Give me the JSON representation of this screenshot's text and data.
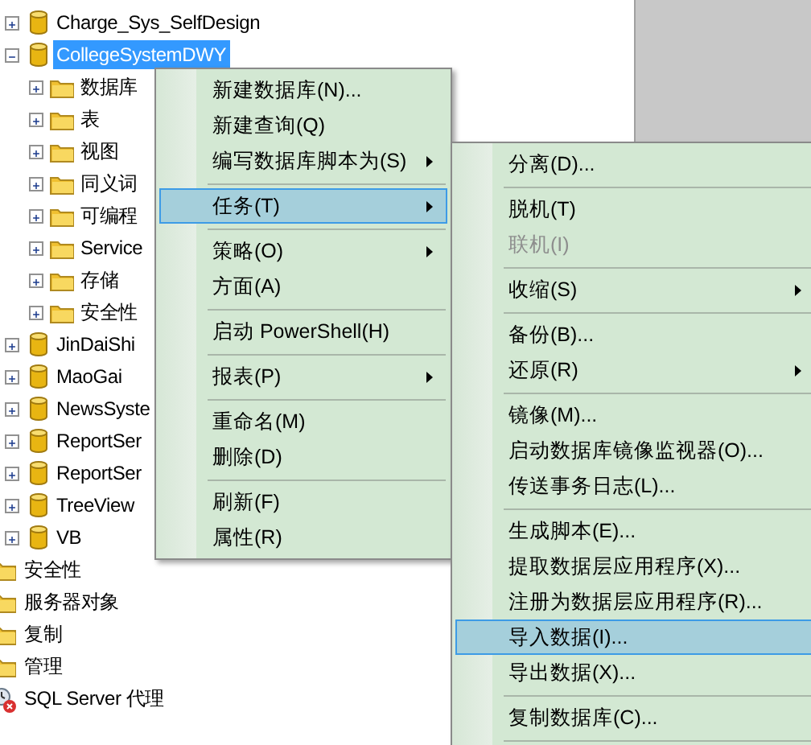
{
  "databases": [
    {
      "label": "Charge_Sys_SelfDesign",
      "expanded": false,
      "selected": false
    },
    {
      "label": "CollegeSystemDWY",
      "expanded": true,
      "selected": true,
      "children": [
        {
          "label": "数据库",
          "expanded": false
        },
        {
          "label": "表",
          "expanded": false
        },
        {
          "label": "视图",
          "expanded": false
        },
        {
          "label": "同义词",
          "expanded": false
        },
        {
          "label": "可编程",
          "expanded": false
        },
        {
          "label": "Service",
          "expanded": false
        },
        {
          "label": "存储",
          "expanded": false
        },
        {
          "label": "安全性",
          "expanded": false
        }
      ]
    },
    {
      "label": "JinDaiShi",
      "expanded": false,
      "selected": false
    },
    {
      "label": "MaoGai",
      "expanded": false,
      "selected": false
    },
    {
      "label": "NewsSyste",
      "expanded": false,
      "selected": false
    },
    {
      "label": "ReportSer",
      "expanded": false,
      "selected": false
    },
    {
      "label": "ReportSer",
      "expanded": false,
      "selected": false
    },
    {
      "label": "TreeView",
      "expanded": false,
      "selected": false
    },
    {
      "label": "VB",
      "expanded": false,
      "selected": false
    }
  ],
  "server_nodes": [
    {
      "label": "安全性",
      "kind": "folder"
    },
    {
      "label": "服务器对象",
      "kind": "folder"
    },
    {
      "label": "复制",
      "kind": "folder"
    },
    {
      "label": "管理",
      "kind": "folder"
    },
    {
      "label": "SQL Server 代理",
      "kind": "agent"
    }
  ],
  "context_menu": [
    {
      "kind": "item",
      "label": "新建数据库(N)...",
      "submenu": false,
      "selected": false
    },
    {
      "kind": "item",
      "label": "新建查询(Q)",
      "submenu": false,
      "selected": false
    },
    {
      "kind": "item",
      "label": "编写数据库脚本为(S)",
      "submenu": true,
      "selected": false
    },
    {
      "kind": "separator"
    },
    {
      "kind": "item",
      "label": "任务(T)",
      "submenu": true,
      "selected": true
    },
    {
      "kind": "separator"
    },
    {
      "kind": "item",
      "label": "策略(O)",
      "submenu": true,
      "selected": false
    },
    {
      "kind": "item",
      "label": "方面(A)",
      "submenu": false,
      "selected": false
    },
    {
      "kind": "separator"
    },
    {
      "kind": "item",
      "label": "启动 PowerShell(H)",
      "submenu": false,
      "selected": false
    },
    {
      "kind": "separator"
    },
    {
      "kind": "item",
      "label": "报表(P)",
      "submenu": true,
      "selected": false
    },
    {
      "kind": "separator"
    },
    {
      "kind": "item",
      "label": "重命名(M)",
      "submenu": false,
      "selected": false
    },
    {
      "kind": "item",
      "label": "删除(D)",
      "submenu": false,
      "selected": false
    },
    {
      "kind": "separator"
    },
    {
      "kind": "item",
      "label": "刷新(F)",
      "submenu": false,
      "selected": false
    },
    {
      "kind": "item",
      "label": "属性(R)",
      "submenu": false,
      "selected": false
    }
  ],
  "tasks_submenu": [
    {
      "kind": "item",
      "label": "分离(D)...",
      "submenu": false,
      "selected": false,
      "disabled": false
    },
    {
      "kind": "separator"
    },
    {
      "kind": "item",
      "label": "脱机(T)",
      "submenu": false,
      "selected": false,
      "disabled": false
    },
    {
      "kind": "item",
      "label": "联机(I)",
      "submenu": false,
      "selected": false,
      "disabled": true
    },
    {
      "kind": "separator"
    },
    {
      "kind": "item",
      "label": "收缩(S)",
      "submenu": true,
      "selected": false,
      "disabled": false
    },
    {
      "kind": "separator"
    },
    {
      "kind": "item",
      "label": "备份(B)...",
      "submenu": false,
      "selected": false,
      "disabled": false
    },
    {
      "kind": "item",
      "label": "还原(R)",
      "submenu": true,
      "selected": false,
      "disabled": false
    },
    {
      "kind": "separator"
    },
    {
      "kind": "item",
      "label": "镜像(M)...",
      "submenu": false,
      "selected": false,
      "disabled": false
    },
    {
      "kind": "item",
      "label": "启动数据库镜像监视器(O)...",
      "submenu": false,
      "selected": false,
      "disabled": false
    },
    {
      "kind": "item",
      "label": "传送事务日志(L)...",
      "submenu": false,
      "selected": false,
      "disabled": false
    },
    {
      "kind": "separator"
    },
    {
      "kind": "item",
      "label": "生成脚本(E)...",
      "submenu": false,
      "selected": false,
      "disabled": false
    },
    {
      "kind": "item",
      "label": "提取数据层应用程序(X)...",
      "submenu": false,
      "selected": false,
      "disabled": false
    },
    {
      "kind": "item",
      "label": "注册为数据层应用程序(R)...",
      "submenu": false,
      "selected": false,
      "disabled": false
    },
    {
      "kind": "item",
      "label": "导入数据(I)...",
      "submenu": false,
      "selected": true,
      "disabled": false
    },
    {
      "kind": "item",
      "label": "导出数据(X)...",
      "submenu": false,
      "selected": false,
      "disabled": false
    },
    {
      "kind": "separator"
    },
    {
      "kind": "item",
      "label": "复制数据库(C)...",
      "submenu": false,
      "selected": false,
      "disabled": false
    },
    {
      "kind": "separator"
    }
  ]
}
